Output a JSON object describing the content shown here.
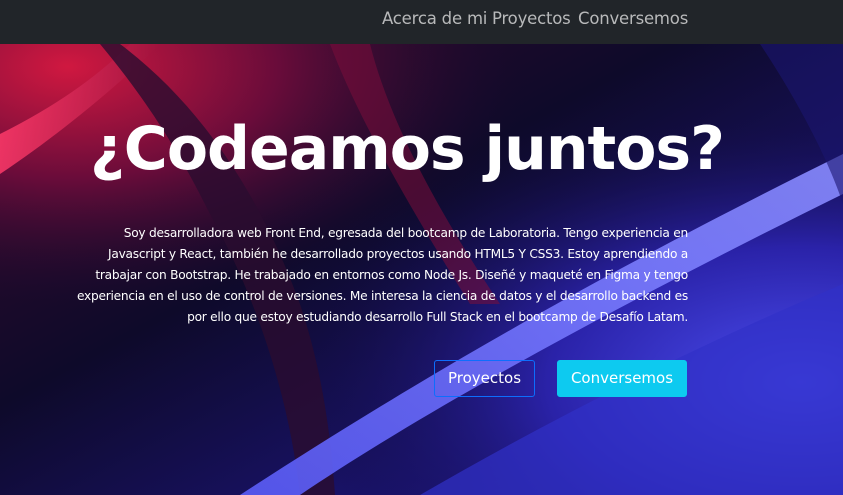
{
  "nav": {
    "links": [
      {
        "label": "Acerca de mi"
      },
      {
        "label": "Proyectos"
      },
      {
        "label": "Conversemos"
      }
    ]
  },
  "hero": {
    "title": "¿Codeamos juntos?",
    "description": "Soy desarrolladora web Front End, egresada del bootcamp de Laboratoria. Tengo experiencia en Javascript y React, también he desarrollado proyectos usando HTML5 Y CSS3. Estoy aprendiendo a trabajar con Bootstrap. He trabajado en entornos como Node Js. Diseñé y maqueté en Figma y tengo experiencia en el uso de control de versiones. Me interesa la ciencia de datos y el desarrollo backend es por ello que estoy estudiando desarrollo Full Stack en el bootcamp de Desafío Latam.",
    "buttons": {
      "projects": "Proyectos",
      "contact": "Conversemos"
    }
  },
  "colors": {
    "navbar": "#212529",
    "nav_link": "#b8b9ba",
    "outline_border": "#0d6efd",
    "info_button": "#0dcaf0",
    "background_dark": "#0b0a24",
    "background_red": "#c0143c",
    "background_blue": "#4040e0"
  }
}
